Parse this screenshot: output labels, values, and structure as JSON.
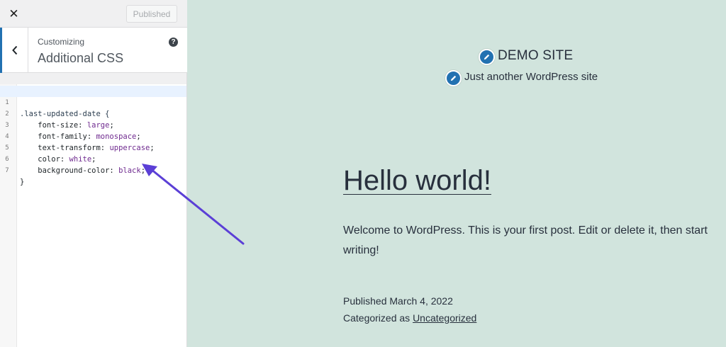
{
  "sidebar": {
    "close_label": "✕",
    "publish_label": "Published",
    "section_context": "Customizing",
    "section_title": "Additional CSS",
    "help_label": "?",
    "code_lines": [
      {
        "num": "1",
        "text": ".last-updated-date {"
      },
      {
        "num": "2",
        "text": "    font-size: large;"
      },
      {
        "num": "3",
        "text": "    font-family: monospace;"
      },
      {
        "num": "4",
        "text": "    text-transform: uppercase;"
      },
      {
        "num": "5",
        "text": "    color: white;"
      },
      {
        "num": "6",
        "text": "    background-color: black;"
      },
      {
        "num": "7",
        "text": "}"
      }
    ]
  },
  "preview": {
    "site_title": "DEMO SITE",
    "site_tagline": "Just another WordPress site",
    "post_title": "Hello world!",
    "post_body": "Welcome to WordPress. This is your first post. Edit or delete it, then start writing!",
    "published_line": "Published March 4, 2022",
    "categorized_prefix": "Categorized as ",
    "category_link": "Uncategorized"
  },
  "colors": {
    "preview_bg": "#d1e4dd",
    "accent": "#2271b1",
    "arrow": "#5b3fd6"
  },
  "icons": {
    "back": "chevron-left-icon",
    "help": "question-circle-icon",
    "edit": "pencil-icon"
  }
}
